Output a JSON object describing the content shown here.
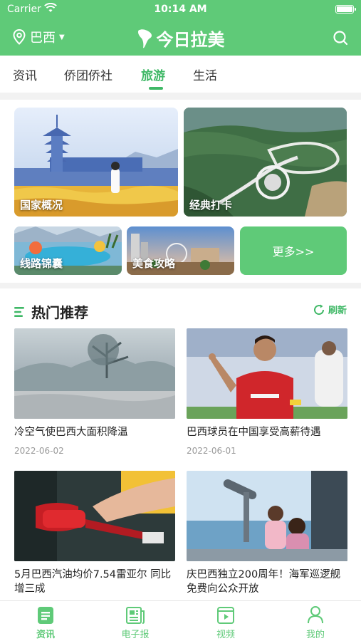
{
  "status": {
    "carrier": "Carrier",
    "time": "10:14 AM"
  },
  "header": {
    "location": "巴西",
    "brand": "今日拉美"
  },
  "tabs": [
    {
      "label": "资讯"
    },
    {
      "label": "侨团侨社"
    },
    {
      "label": "旅游",
      "active": true
    },
    {
      "label": "生活"
    }
  ],
  "travel_tiles": {
    "country": "国家概况",
    "classic": "经典打卡",
    "routes": "线路锦囊",
    "food": "美食攻略",
    "more": "更多>>"
  },
  "hot": {
    "title": "热门推荐",
    "refresh": "刷新",
    "items": [
      {
        "title": "冷空气使巴西大面积降温",
        "date": "2022-06-02"
      },
      {
        "title": "巴西球员在中国享受高薪待遇",
        "date": "2022-06-01"
      },
      {
        "title": "5月巴西汽油均价7.54雷亚尔 同比增三成",
        "date": ""
      },
      {
        "title": "庆巴西独立200周年！海军巡逻舰免费向公众开放",
        "date": ""
      }
    ]
  },
  "bottom_nav": [
    {
      "label": "资讯",
      "icon": "news-icon",
      "active": true
    },
    {
      "label": "电子报",
      "icon": "newspaper-icon"
    },
    {
      "label": "视频",
      "icon": "video-icon"
    },
    {
      "label": "我的",
      "icon": "user-icon"
    }
  ],
  "colors": {
    "brand": "#5fca78",
    "accent": "#3fb866"
  }
}
